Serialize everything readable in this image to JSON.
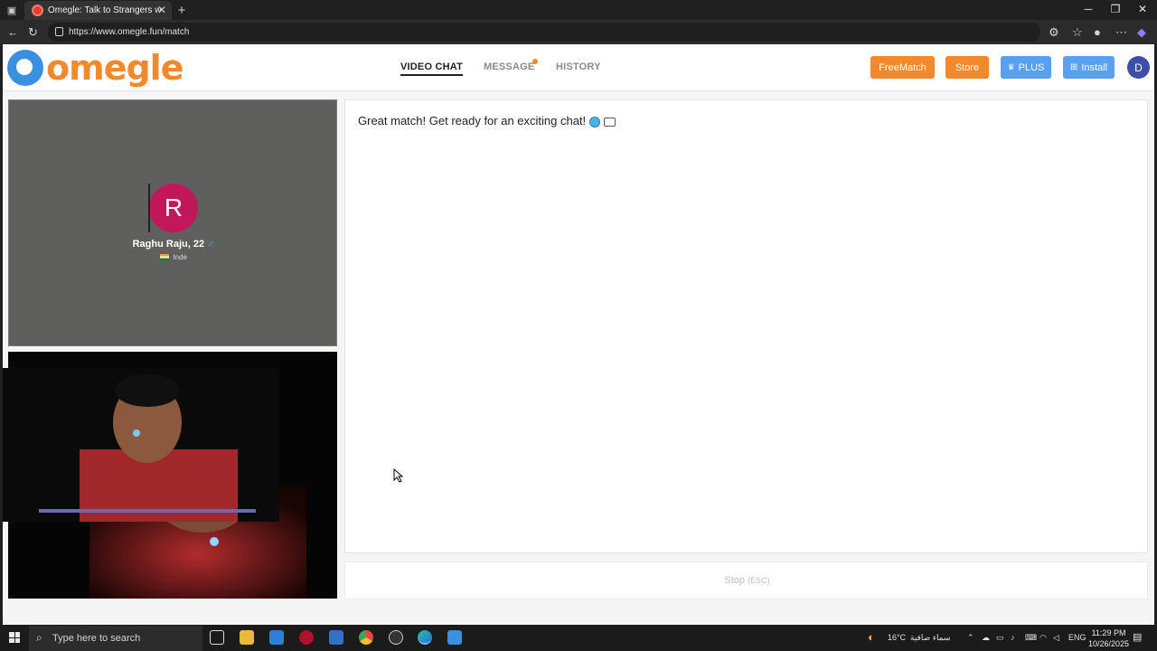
{
  "browser": {
    "tab_title": "Omegle: Talk to Strangers w",
    "url": "https://www.omegle.fun/match"
  },
  "header": {
    "logo_text": "omegle",
    "nav": [
      "VIDEO CHAT",
      "MESSAGE",
      "HISTORY"
    ],
    "buttons": {
      "freematch": "FreeMatch",
      "store": "Store",
      "plus": "PLUS",
      "install": "Install"
    },
    "avatar_initial": "D",
    "colors": {
      "accent_orange": "#f08a2c",
      "accent_blue": "#5aa0f0"
    }
  },
  "remote": {
    "initial": "R",
    "name": "Raghu Raju, 22",
    "country": "Inde",
    "avatar_color": "#c2185b"
  },
  "chat": {
    "message": "Great match! Get ready for an exciting chat!"
  },
  "stop": {
    "label": "Stop",
    "shortcut": "(ESC)"
  },
  "taskbar": {
    "search_placeholder": "Type here to search",
    "weather_temp": "16°C",
    "weather_text": "سماء صافية",
    "language": "ENG",
    "time": "11:29 PM",
    "date": "10/26/2025"
  }
}
